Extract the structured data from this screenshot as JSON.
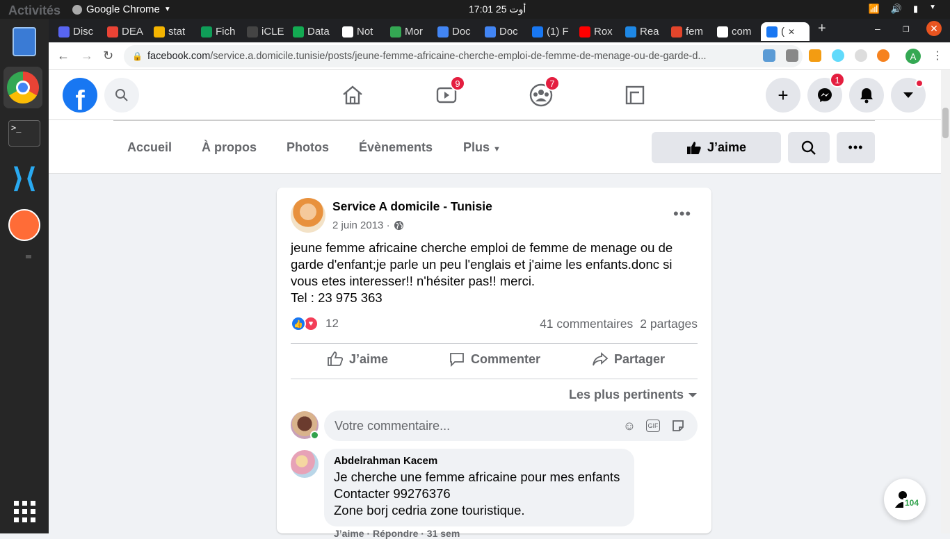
{
  "system": {
    "activities": "Activités",
    "app_name": "Google Chrome",
    "clock": "17:01 25 أوت"
  },
  "browser": {
    "tabs": [
      {
        "label": "Disc",
        "color": "#5865f2"
      },
      {
        "label": "DEA",
        "color": "#ea4335"
      },
      {
        "label": "stat",
        "color": "#f4b400"
      },
      {
        "label": "Fich",
        "color": "#0f9d58"
      },
      {
        "label": "iCLE",
        "color": "#444444"
      },
      {
        "label": "Data",
        "color": "#13aa52"
      },
      {
        "label": "Not",
        "color": "#ffffff"
      },
      {
        "label": "Mor",
        "color": "#34a853"
      },
      {
        "label": "Doc",
        "color": "#4285f4"
      },
      {
        "label": "Doc",
        "color": "#4285f4"
      },
      {
        "label": "(1) F",
        "color": "#1877f2"
      },
      {
        "label": "Rox",
        "color": "#ff0000"
      },
      {
        "label": "Rea",
        "color": "#1e88e5"
      },
      {
        "label": "fem",
        "color": "#e2452b"
      },
      {
        "label": "com",
        "color": "#ffffff"
      },
      {
        "label": "(",
        "color": "#1877f2"
      }
    ],
    "url_host": "facebook.com",
    "url_path": "/service.a.domicile.tunisie/posts/jeune-femme-africaine-cherche-emploi-de-femme-de-menage-ou-de-garde-d...",
    "profile_initial": "A"
  },
  "facebook": {
    "logo": "f",
    "badges": {
      "watch": "9",
      "groups": "7",
      "messenger": "1"
    },
    "page_tabs": [
      "Accueil",
      "À propos",
      "Photos",
      "Évènements",
      "Plus"
    ],
    "like_button": "J’aime"
  },
  "post": {
    "author": "Service A domicile - Tunisie",
    "date": "2 juin 2013 ·",
    "lines": [
      "jeune femme africaine cherche emploi de femme de menage ou de",
      "garde d'enfant;je parle un peu l'englais et j'aime les enfants.donc si",
      "vous etes interesser!! n'hésiter pas!! merci.",
      "Tel : 23 975 363"
    ],
    "reaction_count": "12",
    "comments": "41 commentaires",
    "shares": "2 partages",
    "actions": {
      "like": "J’aime",
      "comment": "Commenter",
      "share": "Partager"
    },
    "sort": "Les plus pertinents",
    "comment_placeholder": "Votre commentaire...",
    "first_comment": {
      "author": "Abdelrahman Kacem",
      "text": "Je cherche une femme africaine pour mes enfants\nContacter 99276376\nZone borj cedria zone touristique.",
      "links": "J’aime · Répondre · 31 sem"
    }
  },
  "contacts_count": "104"
}
